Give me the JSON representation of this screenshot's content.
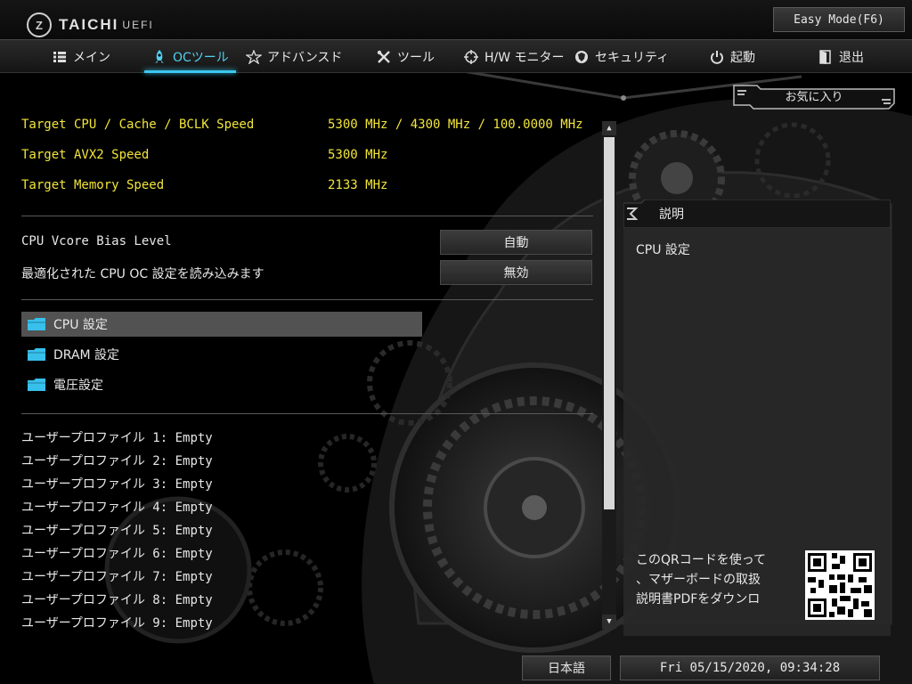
{
  "header": {
    "logo_text": "TAICHI",
    "logo_sub": "UEFI",
    "easy_mode_label": "Easy Mode(F6)"
  },
  "nav": {
    "items": [
      {
        "label": "メイン",
        "icon": "list-icon"
      },
      {
        "label": "OCツール",
        "icon": "rocket-icon"
      },
      {
        "label": "アドバンスド",
        "icon": "star-icon"
      },
      {
        "label": "ツール",
        "icon": "tools-icon"
      },
      {
        "label": "H/W モニター",
        "icon": "crosshair-icon"
      },
      {
        "label": "セキュリティ",
        "icon": "shield-icon"
      },
      {
        "label": "起動",
        "icon": "power-icon"
      },
      {
        "label": "退出",
        "icon": "exit-icon"
      }
    ],
    "active": "OCツール"
  },
  "favorite_label": "お気に入り",
  "targets": [
    {
      "label": "Target CPU / Cache / BCLK Speed",
      "value": "5300 MHz / 4300 MHz / 100.0000 MHz"
    },
    {
      "label": "Target AVX2 Speed",
      "value": "5300 MHz"
    },
    {
      "label": "Target Memory Speed",
      "value": "2133 MHz"
    }
  ],
  "settings": [
    {
      "label": "CPU Vcore Bias Level",
      "value": "自動"
    },
    {
      "label": "最適化された CPU OC 設定を読み込みます",
      "value": "無効"
    }
  ],
  "folders": [
    {
      "label": "CPU 設定",
      "selected": true
    },
    {
      "label": "DRAM 設定",
      "selected": false
    },
    {
      "label": "電圧設定",
      "selected": false
    }
  ],
  "profiles": [
    "ユーザープロファイル 1: Empty",
    "ユーザープロファイル 2: Empty",
    "ユーザープロファイル 3: Empty",
    "ユーザープロファイル 4: Empty",
    "ユーザープロファイル 5: Empty",
    "ユーザープロファイル 6: Empty",
    "ユーザープロファイル 7: Empty",
    "ユーザープロファイル 8: Empty",
    "ユーザープロファイル 9: Empty"
  ],
  "description": {
    "title": "説明",
    "text": "CPU 設定",
    "qr_text_lines": [
      "このQRコードを使って",
      "、マザーボードの取扱",
      "説明書PDFをダウンロ"
    ]
  },
  "footer": {
    "language": "日本語",
    "datetime": "Fri 05/15/2020, 09:34:28"
  },
  "colors": {
    "accent": "#3cc7ef",
    "highlight_text": "#f2e53a",
    "folder_icon": "#38c0ec"
  }
}
